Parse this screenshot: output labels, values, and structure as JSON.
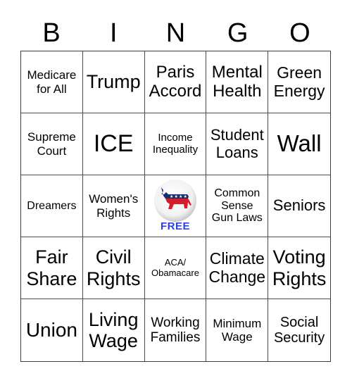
{
  "header": {
    "letters": [
      "B",
      "I",
      "N",
      "G",
      "O"
    ]
  },
  "free": {
    "label": "FREE",
    "icon": "democratic-donkey-button-icon",
    "colors": {
      "blue": "#1c2a6e",
      "red": "#d21f2b",
      "label": "#2a3ee8"
    }
  },
  "cells": [
    {
      "text": "Medicare\nfor All",
      "size": 17
    },
    {
      "text": "Trump",
      "size": 27
    },
    {
      "text": "Paris\nAccord",
      "size": 24
    },
    {
      "text": "Mental\nHealth",
      "size": 24
    },
    {
      "text": "Green\nEnergy",
      "size": 23
    },
    {
      "text": "Supreme\nCourt",
      "size": 17
    },
    {
      "text": "ICE",
      "size": 34
    },
    {
      "text": "Income\nInequality",
      "size": 15
    },
    {
      "text": "Student\nLoans",
      "size": 22
    },
    {
      "text": "Wall",
      "size": 33
    },
    {
      "text": "Dreamers",
      "size": 16
    },
    {
      "text": "Women's\nRights",
      "size": 17
    },
    {
      "text": "FREE",
      "size": 15,
      "free": true
    },
    {
      "text": "Common\nSense\nGun Laws",
      "size": 16
    },
    {
      "text": "Seniors",
      "size": 22
    },
    {
      "text": "Fair\nShare",
      "size": 27
    },
    {
      "text": "Civil\nRights",
      "size": 27
    },
    {
      "text": "ACA/\nObamacare",
      "size": 13
    },
    {
      "text": "Climate\nChange",
      "size": 23
    },
    {
      "text": "Voting\nRights",
      "size": 27
    },
    {
      "text": "Union",
      "size": 28
    },
    {
      "text": "Living\nWage",
      "size": 27
    },
    {
      "text": "Working\nFamilies",
      "size": 19
    },
    {
      "text": "Minimum\nWage",
      "size": 17
    },
    {
      "text": "Social\nSecurity",
      "size": 20
    }
  ]
}
